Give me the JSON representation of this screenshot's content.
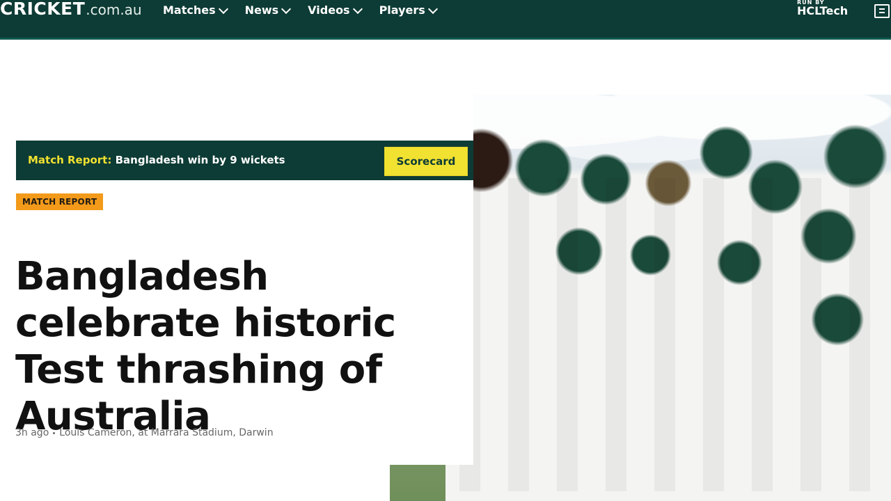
{
  "header": {
    "logo_main": "CRICKET",
    "logo_domain": ".com.au",
    "nav": [
      "Matches",
      "News",
      "Videos",
      "Players"
    ],
    "sponsor_small": "RUN BY",
    "sponsor_name": "HCLTech",
    "ticket_icon": "ticket-icon"
  },
  "match_bar": {
    "label": "Match Report:",
    "summary": "Bangladesh win by 9 wickets",
    "button": "Scorecard"
  },
  "article": {
    "tag": "MATCH REPORT",
    "headline_lines": [
      "Bangladesh",
      "celebrate historic",
      "Test thrashing of",
      "Australia"
    ],
    "time": "3h ago",
    "byline": "Louis Cameron, at Marrara Stadium, Darwin"
  },
  "colors": {
    "header_bg": "#0d3b35",
    "accent_yellow": "#f1e130",
    "tag_orange": "#f39a1a"
  }
}
